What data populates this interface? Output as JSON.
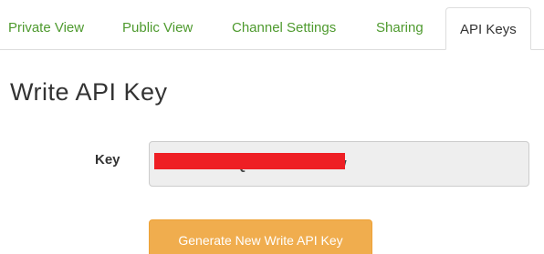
{
  "tabs": [
    {
      "label": "Private View",
      "active": false
    },
    {
      "label": "Public View",
      "active": false
    },
    {
      "label": "Channel Settings",
      "active": false
    },
    {
      "label": "Sharing",
      "active": false
    },
    {
      "label": "API Keys",
      "active": true
    }
  ],
  "section": {
    "title": "Write API Key"
  },
  "key_field": {
    "label": "Key",
    "value": "7S2Y0S... (redacted)",
    "redacted": true,
    "redaction_color": "#ee1f24"
  },
  "actions": {
    "generate_label": "Generate New Write API Key"
  },
  "colors": {
    "tab_link": "#4e9a2e",
    "button": "#f0ad4e"
  }
}
